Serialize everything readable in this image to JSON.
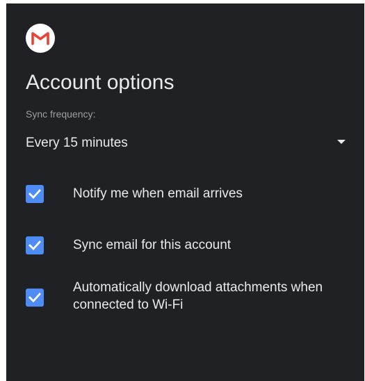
{
  "header": {
    "logo_icon": "gmail-icon",
    "title": "Account options"
  },
  "sync": {
    "label": "Sync frequency:",
    "selected": "Every 15 minutes"
  },
  "options": [
    {
      "label": "Notify me when email arrives",
      "checked": true
    },
    {
      "label": "Sync email for this account",
      "checked": true
    },
    {
      "label": "Automatically download attachments when connected to Wi-Fi",
      "checked": true
    }
  ],
  "colors": {
    "background": "#202124",
    "checkbox": "#4d8df5",
    "gmail_red": "#ea4335",
    "text": "#e8eaed",
    "secondary_text": "#9aa0a6"
  }
}
